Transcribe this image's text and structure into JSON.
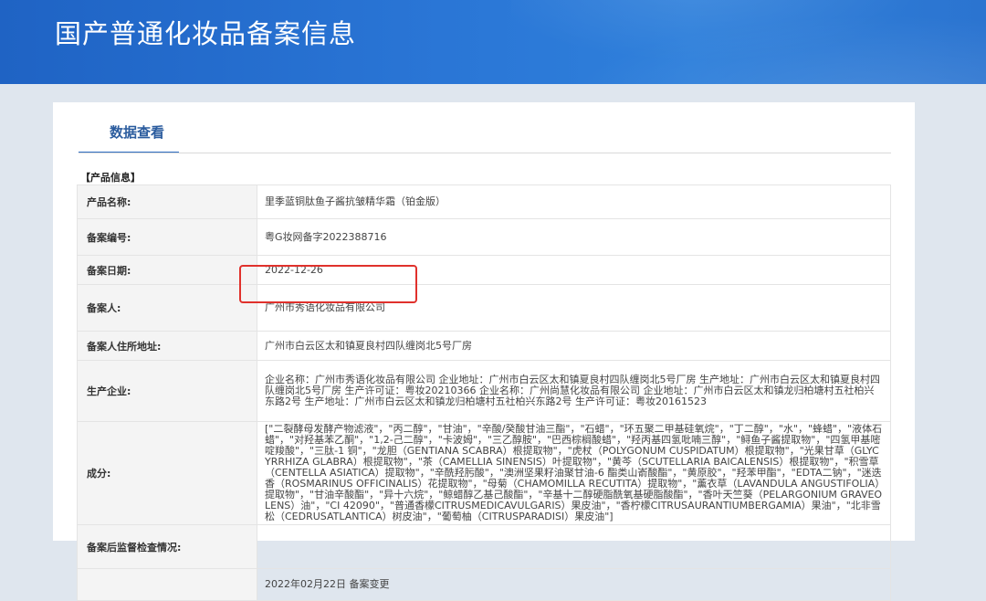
{
  "header": {
    "title": "国产普通化妆品备案信息"
  },
  "tabs": [
    {
      "label": "数据查看"
    }
  ],
  "section": {
    "title": "【产品信息】"
  },
  "rows": [
    {
      "label": "产品名称:",
      "value": "里季蓝铜肽鱼子酱抗皱精华霜（铂金版）"
    },
    {
      "label": "备案编号:",
      "value": "粤G妆网备字2022388716"
    },
    {
      "label": "备案日期:",
      "value": "2022-12-26"
    },
    {
      "label": "备案人:",
      "value": "广州市秀语化妆品有限公司"
    },
    {
      "label": "备案人住所地址:",
      "value": "广州市白云区太和镇夏良村四队缠岗北5号厂房"
    },
    {
      "label": "生产企业:",
      "value": "企业名称：广州市秀语化妆品有限公司 企业地址：广州市白云区太和镇夏良村四队缠岗北5号厂房 生产地址：广州市白云区太和镇夏良村四队缠岗北5号厂房 生产许可证：粤妆20210366 企业名称：广州尚慧化妆品有限公司 企业地址：广州市白云区太和镇龙归柏塘村五社柏兴东路2号 生产地址：广州市白云区太和镇龙归柏塘村五社柏兴东路2号 生产许可证：粤妆20161523"
    },
    {
      "label": "成分:",
      "value": "[\"二裂酵母发酵产物滤液\"，\"丙二醇\"，\"甘油\"，\"辛酸/癸酸甘油三酯\"，\"石蜡\"，\"环五聚二甲基硅氧烷\"，\"丁二醇\"，\"水\"，\"蜂蜡\"，\"液体石蜡\"，\"对羟基苯乙酮\"，\"1,2-己二醇\"，\"卡波姆\"，\"三乙醇胺\"，\"巴西棕榈酸蜡\"，\"羟丙基四氢吡喃三醇\"，\"鲟鱼子酱提取物\"，\"四氢甲基嘧啶羧酸\"，\"三肽-1 铜\"，\"龙胆（GENTIANA SCABRA）根提取物\"，\"虎杖（POLYGONUM CUSPIDATUM）根提取物\"，\"光果甘草（GLYCYRRHIZA GLABRA）根提取物\"，\"茶（CAMELLIA SINENSIS）叶提取物\"，\"黄芩（SCUTELLARIA BAICALENSIS）根提取物\"，\"积雪草（CENTELLA ASIATICA）提取物\"，\"辛酰羟肟酸\"，\"澳洲坚果籽油聚甘油-6 酯类山嵛酸酯\"，\"黄原胶\"，\"羟苯甲酯\"，\"EDTA二钠\"，\"迷迭香（ROSMARINUS OFFICINALIS）花提取物\"，\"母菊（CHAMOMILLA RECUTITA）提取物\"，\"薰衣草（LAVANDULA ANGUSTIFOLIA）提取物\"，\"甘油辛酸酯\"，\"异十六烷\"，\"鲸蜡醇乙基己酸酯\"，\"辛基十二醇硬脂酰氧基硬脂酸酯\"，\"香叶天竺葵（PELARGONIUM GRAVEOLENS）油\"，\"CI 42090\"，\"普通香檬CITRUSMEDICAVULGARIS）果皮油\"，\"香柠檬CITRUSAURANTIUMBERGAMIA）果油\"，\"北非雪松（CEDRUSATLANTICA）树皮油\"，\"葡萄柚（CITRUSPARADISI）果皮油\"]"
    },
    {
      "label": "备案后监督检查情况:",
      "value": ""
    },
    {
      "label": "",
      "value": "2022年02月22日 备案变更"
    }
  ]
}
